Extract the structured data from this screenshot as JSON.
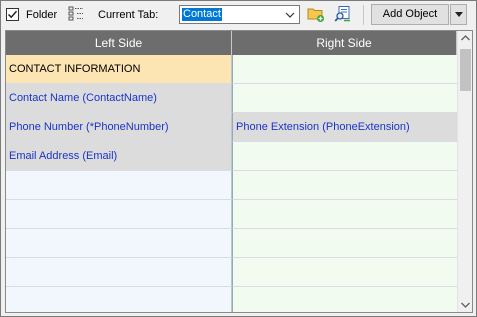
{
  "toolbar": {
    "folder_checked": true,
    "folder_label": "Folder",
    "current_tab_label": "Current Tab:",
    "current_tab_value": "Contact",
    "add_object_label": "Add Object",
    "icons": {
      "checkbox": "checkmark-icon",
      "tree": "tree-view-icon",
      "new_folder": "folder-add-icon",
      "browse": "search-icon",
      "dropdown": "chevron-down-icon"
    }
  },
  "grid": {
    "columns": [
      "Left Side",
      "Right Side"
    ],
    "rows": [
      {
        "left": "CONTACT INFORMATION",
        "right": "",
        "style": "section"
      },
      {
        "left": "Contact Name (ContactName)",
        "right": "",
        "style": "field"
      },
      {
        "left": "Phone Number (*PhoneNumber)",
        "right": "Phone Extension (PhoneExtension)",
        "style": "field-both"
      },
      {
        "left": "Email Address (Email)",
        "right": "",
        "style": "field"
      },
      {
        "left": "",
        "right": "",
        "style": "empty"
      },
      {
        "left": "",
        "right": "",
        "style": "empty"
      },
      {
        "left": "",
        "right": "",
        "style": "empty"
      },
      {
        "left": "",
        "right": "",
        "style": "empty"
      },
      {
        "left": "",
        "right": "",
        "style": "empty"
      }
    ]
  },
  "colors": {
    "header_bg": "#6d6d6d",
    "section_bg": "#fde5b3",
    "field_bg": "#dcdcdc",
    "left_empty_bg": "#f2f7fd",
    "right_empty_bg": "#f1fbf0",
    "link_text": "#1a35c8",
    "selection": "#0078d7"
  }
}
